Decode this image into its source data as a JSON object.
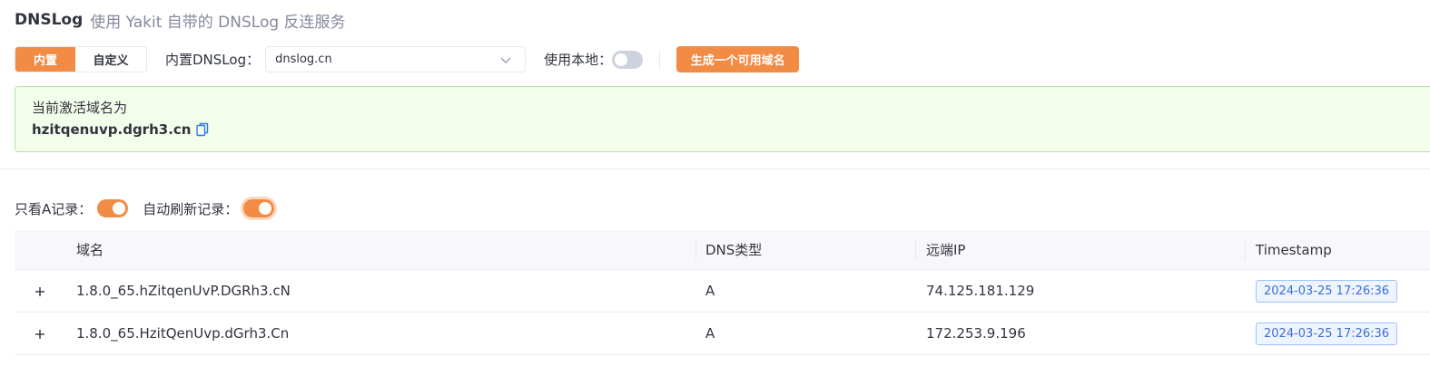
{
  "header": {
    "title": "DNSLog",
    "subtitle": "使用 Yakit 自带的 DNSLog 反连服务"
  },
  "controls": {
    "mode_tabs": [
      "内置",
      "自定义"
    ],
    "active_tab": "内置",
    "builtin_label": "内置DNSLog：",
    "builtin_select_value": "dnslog.cn",
    "use_local_label": "使用本地：",
    "use_local_on": false,
    "generate_button": "生成一个可用域名"
  },
  "active_domain": {
    "label": "当前激活域名为",
    "domain": "hzitqenuvp.dgrh3.cn"
  },
  "filters": {
    "only_a_label": "只看A记录：",
    "only_a_on": true,
    "auto_refresh_label": "自动刷新记录：",
    "auto_refresh_on": true
  },
  "table": {
    "columns": [
      "域名",
      "DNS类型",
      "远端IP",
      "Timestamp"
    ],
    "rows": [
      {
        "domain": "1.8.0_65.hZitqenUvP.DGRh3.cN",
        "type": "A",
        "ip": "74.125.181.129",
        "timestamp": "2024-03-25 17:26:36"
      },
      {
        "domain": "1.8.0_65.HzitQenUvp.dGrh3.Cn",
        "type": "A",
        "ip": "172.253.9.196",
        "timestamp": "2024-03-25 17:26:36"
      }
    ]
  },
  "colors": {
    "accent": "#f28b44",
    "success_bg": "#f4fcea",
    "success_border": "#b6e89b",
    "tag_blue": "#3f6fd0"
  },
  "icons": {
    "select_arrow": "chevron-down-icon",
    "copy": "copy-icon",
    "expand": "plus-icon"
  }
}
